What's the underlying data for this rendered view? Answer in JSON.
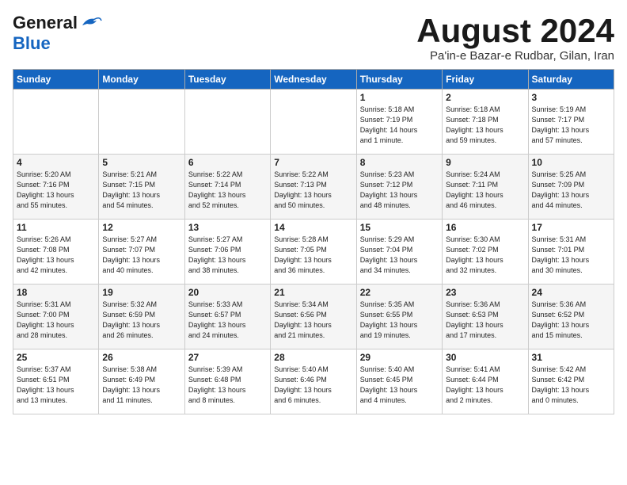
{
  "header": {
    "logo_line1": "General",
    "logo_line2": "Blue",
    "month_title": "August 2024",
    "subtitle": "Pa'in-e Bazar-e Rudbar, Gilan, Iran"
  },
  "weekdays": [
    "Sunday",
    "Monday",
    "Tuesday",
    "Wednesday",
    "Thursday",
    "Friday",
    "Saturday"
  ],
  "weeks": [
    [
      {
        "day": "",
        "info": ""
      },
      {
        "day": "",
        "info": ""
      },
      {
        "day": "",
        "info": ""
      },
      {
        "day": "",
        "info": ""
      },
      {
        "day": "1",
        "info": "Sunrise: 5:18 AM\nSunset: 7:19 PM\nDaylight: 14 hours\nand 1 minute."
      },
      {
        "day": "2",
        "info": "Sunrise: 5:18 AM\nSunset: 7:18 PM\nDaylight: 13 hours\nand 59 minutes."
      },
      {
        "day": "3",
        "info": "Sunrise: 5:19 AM\nSunset: 7:17 PM\nDaylight: 13 hours\nand 57 minutes."
      }
    ],
    [
      {
        "day": "4",
        "info": "Sunrise: 5:20 AM\nSunset: 7:16 PM\nDaylight: 13 hours\nand 55 minutes."
      },
      {
        "day": "5",
        "info": "Sunrise: 5:21 AM\nSunset: 7:15 PM\nDaylight: 13 hours\nand 54 minutes."
      },
      {
        "day": "6",
        "info": "Sunrise: 5:22 AM\nSunset: 7:14 PM\nDaylight: 13 hours\nand 52 minutes."
      },
      {
        "day": "7",
        "info": "Sunrise: 5:22 AM\nSunset: 7:13 PM\nDaylight: 13 hours\nand 50 minutes."
      },
      {
        "day": "8",
        "info": "Sunrise: 5:23 AM\nSunset: 7:12 PM\nDaylight: 13 hours\nand 48 minutes."
      },
      {
        "day": "9",
        "info": "Sunrise: 5:24 AM\nSunset: 7:11 PM\nDaylight: 13 hours\nand 46 minutes."
      },
      {
        "day": "10",
        "info": "Sunrise: 5:25 AM\nSunset: 7:09 PM\nDaylight: 13 hours\nand 44 minutes."
      }
    ],
    [
      {
        "day": "11",
        "info": "Sunrise: 5:26 AM\nSunset: 7:08 PM\nDaylight: 13 hours\nand 42 minutes."
      },
      {
        "day": "12",
        "info": "Sunrise: 5:27 AM\nSunset: 7:07 PM\nDaylight: 13 hours\nand 40 minutes."
      },
      {
        "day": "13",
        "info": "Sunrise: 5:27 AM\nSunset: 7:06 PM\nDaylight: 13 hours\nand 38 minutes."
      },
      {
        "day": "14",
        "info": "Sunrise: 5:28 AM\nSunset: 7:05 PM\nDaylight: 13 hours\nand 36 minutes."
      },
      {
        "day": "15",
        "info": "Sunrise: 5:29 AM\nSunset: 7:04 PM\nDaylight: 13 hours\nand 34 minutes."
      },
      {
        "day": "16",
        "info": "Sunrise: 5:30 AM\nSunset: 7:02 PM\nDaylight: 13 hours\nand 32 minutes."
      },
      {
        "day": "17",
        "info": "Sunrise: 5:31 AM\nSunset: 7:01 PM\nDaylight: 13 hours\nand 30 minutes."
      }
    ],
    [
      {
        "day": "18",
        "info": "Sunrise: 5:31 AM\nSunset: 7:00 PM\nDaylight: 13 hours\nand 28 minutes."
      },
      {
        "day": "19",
        "info": "Sunrise: 5:32 AM\nSunset: 6:59 PM\nDaylight: 13 hours\nand 26 minutes."
      },
      {
        "day": "20",
        "info": "Sunrise: 5:33 AM\nSunset: 6:57 PM\nDaylight: 13 hours\nand 24 minutes."
      },
      {
        "day": "21",
        "info": "Sunrise: 5:34 AM\nSunset: 6:56 PM\nDaylight: 13 hours\nand 21 minutes."
      },
      {
        "day": "22",
        "info": "Sunrise: 5:35 AM\nSunset: 6:55 PM\nDaylight: 13 hours\nand 19 minutes."
      },
      {
        "day": "23",
        "info": "Sunrise: 5:36 AM\nSunset: 6:53 PM\nDaylight: 13 hours\nand 17 minutes."
      },
      {
        "day": "24",
        "info": "Sunrise: 5:36 AM\nSunset: 6:52 PM\nDaylight: 13 hours\nand 15 minutes."
      }
    ],
    [
      {
        "day": "25",
        "info": "Sunrise: 5:37 AM\nSunset: 6:51 PM\nDaylight: 13 hours\nand 13 minutes."
      },
      {
        "day": "26",
        "info": "Sunrise: 5:38 AM\nSunset: 6:49 PM\nDaylight: 13 hours\nand 11 minutes."
      },
      {
        "day": "27",
        "info": "Sunrise: 5:39 AM\nSunset: 6:48 PM\nDaylight: 13 hours\nand 8 minutes."
      },
      {
        "day": "28",
        "info": "Sunrise: 5:40 AM\nSunset: 6:46 PM\nDaylight: 13 hours\nand 6 minutes."
      },
      {
        "day": "29",
        "info": "Sunrise: 5:40 AM\nSunset: 6:45 PM\nDaylight: 13 hours\nand 4 minutes."
      },
      {
        "day": "30",
        "info": "Sunrise: 5:41 AM\nSunset: 6:44 PM\nDaylight: 13 hours\nand 2 minutes."
      },
      {
        "day": "31",
        "info": "Sunrise: 5:42 AM\nSunset: 6:42 PM\nDaylight: 13 hours\nand 0 minutes."
      }
    ]
  ]
}
